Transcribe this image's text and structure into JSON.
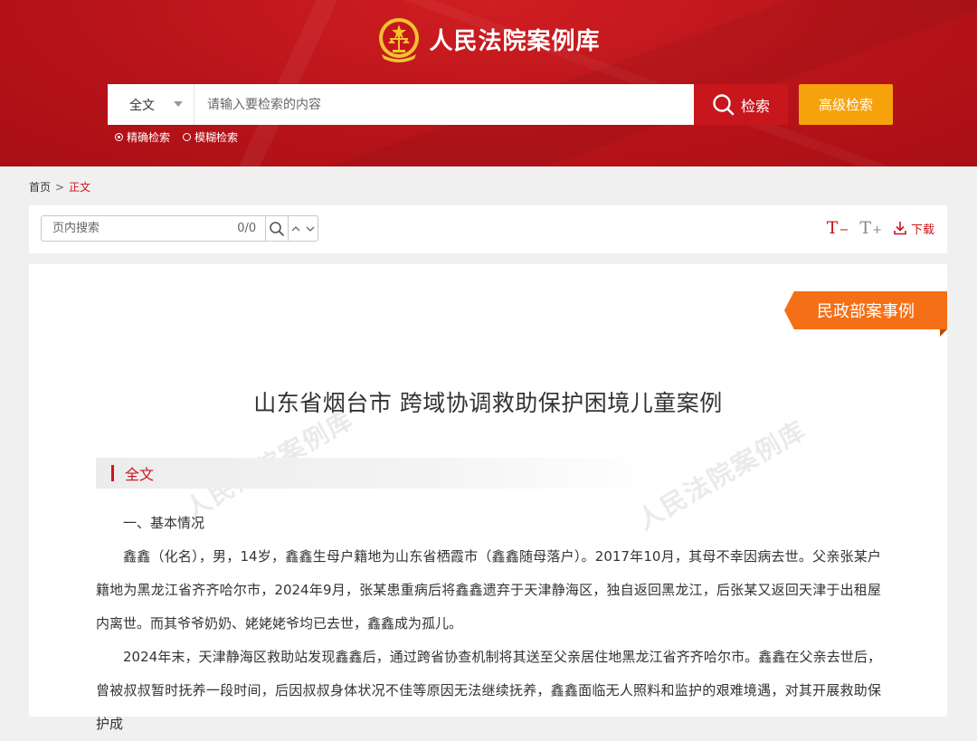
{
  "header": {
    "site_title": "人民法院案例库",
    "search": {
      "scope_selected": "全文",
      "placeholder": "请输入要检索的内容",
      "search_label": "检索",
      "advanced_label": "高级检索"
    },
    "modes": [
      {
        "label": "精确检索",
        "selected": true
      },
      {
        "label": "模糊检索",
        "selected": false
      }
    ]
  },
  "breadcrumb": {
    "home": "首页",
    "separator": ">",
    "current": "正文"
  },
  "toolbar": {
    "find_placeholder": "页内搜索",
    "find_count": "0/0",
    "font_smaller": "T",
    "font_smaller_sign": "−",
    "font_larger": "T",
    "font_larger_sign": "+",
    "download_label": "下载"
  },
  "document": {
    "tag": "民政部案事例",
    "title": "山东省烟台市 跨域协调救助保护困境儿童案例",
    "section_label": "全文",
    "watermark": "人民法院案例库",
    "paragraphs": [
      "一、基本情况",
      "鑫鑫（化名），男，14岁，鑫鑫生母户籍地为山东省栖霞市（鑫鑫随母落户）。2017年10月，其母不幸因病去世。父亲张某户籍地为黑龙江省齐齐哈尔市，2024年9月，张某患重病后将鑫鑫遗弃于天津静海区，独自返回黑龙江，后张某又返回天津于出租屋内离世。而其爷爷奶奶、姥姥姥爷均已去世，鑫鑫成为孤儿。",
      "2024年末，天津静海区救助站发现鑫鑫后，通过跨省协查机制将其送至父亲居住地黑龙江省齐齐哈尔市。鑫鑫在父亲去世后，曾被叔叔暂时抚养一段时间，后因叔叔身体状况不佳等原因无法继续抚养，鑫鑫面临无人照料和监护的艰难境遇，对其开展救助保护成"
    ]
  },
  "colors": {
    "brand_red": "#c8161d",
    "advanced_orange": "#f6a20d",
    "ribbon_orange": "#f56f16"
  }
}
